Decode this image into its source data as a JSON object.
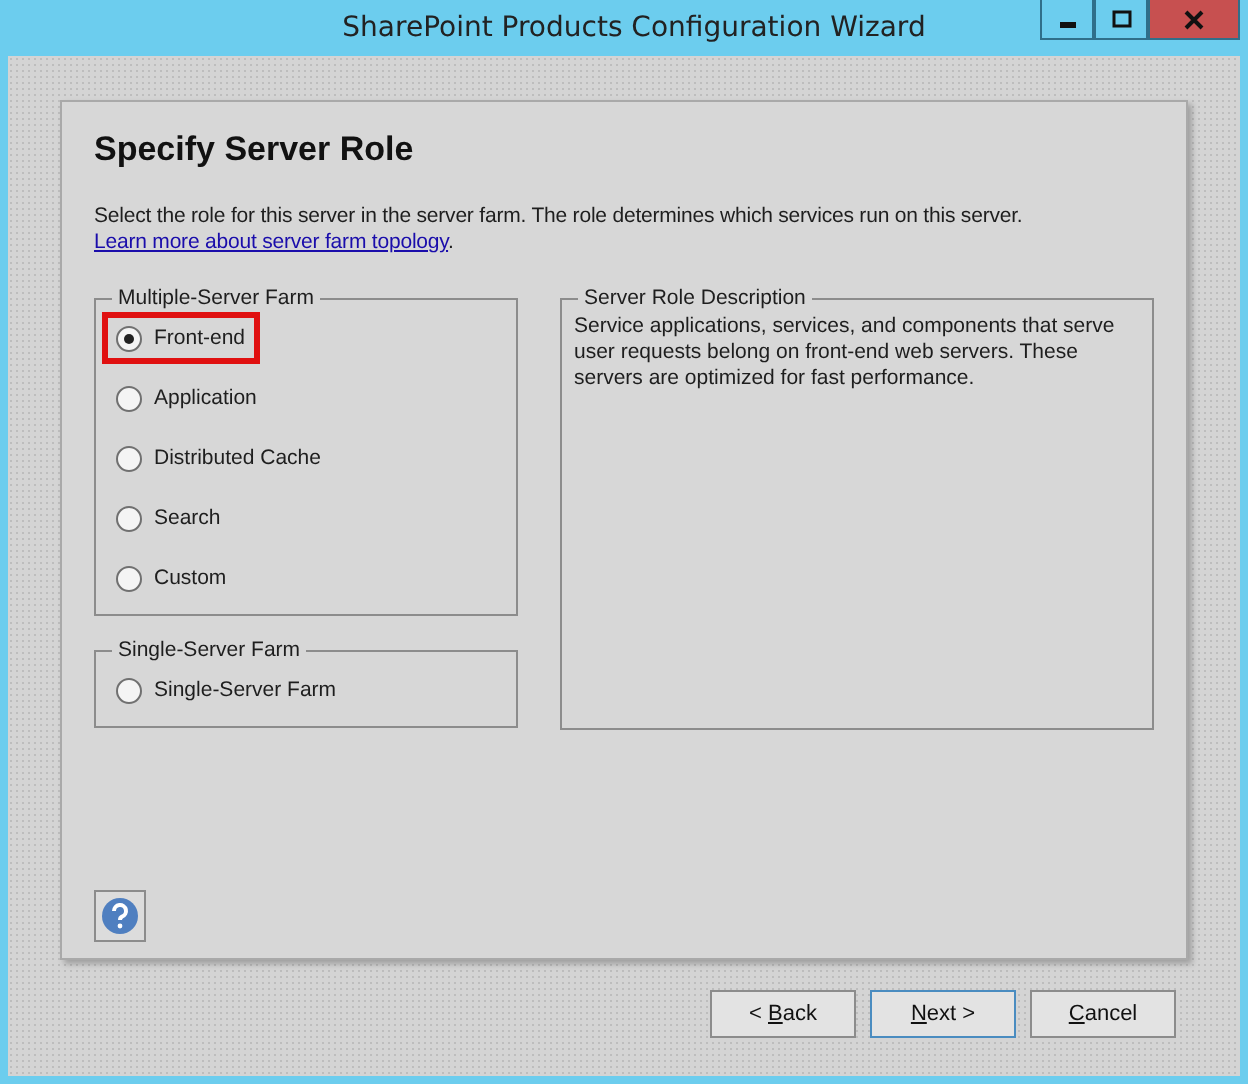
{
  "window": {
    "title": "SharePoint Products Configuration Wizard"
  },
  "page": {
    "title": "Specify Server Role",
    "intro": "Select the role for this server in the server farm. The role determines which services run on this server.",
    "link": "Learn more about server farm topology",
    "after_link": "."
  },
  "groups": [
    {
      "title": "Multiple-Server Farm",
      "options": [
        {
          "label": "Front-end",
          "selected": true,
          "highlighted": true
        },
        {
          "label": "Application",
          "selected": false,
          "highlighted": false
        },
        {
          "label": "Distributed Cache",
          "selected": false,
          "highlighted": false
        },
        {
          "label": "Search",
          "selected": false,
          "highlighted": false
        },
        {
          "label": "Custom",
          "selected": false,
          "highlighted": false
        }
      ]
    },
    {
      "title": "Single-Server Farm",
      "options": [
        {
          "label": "Single-Server Farm",
          "selected": false,
          "highlighted": false
        }
      ]
    }
  ],
  "description": {
    "title": "Server Role Description",
    "text": "Service applications, services, and components that serve user requests belong on front-end web servers. These servers are optimized for fast performance."
  },
  "buttons": [
    {
      "before": "< ",
      "key": "B",
      "after": "ack",
      "focused": false
    },
    {
      "key": "N",
      "after": "ext  >",
      "focused": true
    },
    {
      "key": "C",
      "after": "ancel",
      "focused": false
    }
  ]
}
